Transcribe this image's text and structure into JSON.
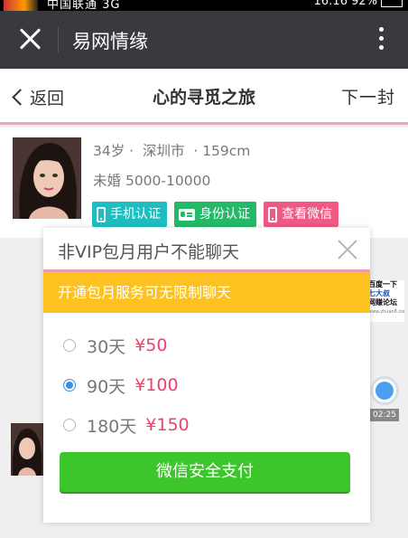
{
  "status_bar": {
    "carrier": "中国联通 3G",
    "time_battery": "16:16 92%"
  },
  "title_bar": {
    "title": "易网情缘"
  },
  "header": {
    "back_label": "返回",
    "title": "心的寻觅之旅",
    "next_label": "下一封"
  },
  "profile": {
    "age": "34岁",
    "city": "深圳市",
    "height": "159cm",
    "marital": "未婚",
    "income": "5000-10000",
    "badges": [
      {
        "label": "手机认证",
        "icon": "phone-icon",
        "color": "#1fbdbf"
      },
      {
        "label": "身份认证",
        "icon": "id-card-icon",
        "color": "#24b968"
      },
      {
        "label": "查看微信",
        "icon": "phone-icon",
        "color": "#ef5a84"
      }
    ]
  },
  "background": {
    "ad_lines": [
      "百度一下",
      "七大叔",
      "网赚论坛",
      "www.zhuan8.com"
    ],
    "voice_duration": "02:25"
  },
  "modal": {
    "title": "非VIP包月用户不能聊天",
    "banner": "开通包月服务可无限制聊天",
    "options": [
      {
        "days": "30天",
        "price": "¥50",
        "selected": false
      },
      {
        "days": "90天",
        "price": "¥100",
        "selected": true
      },
      {
        "days": "180天",
        "price": "¥150",
        "selected": false
      }
    ],
    "pay_label": "微信安全支付"
  },
  "colors": {
    "accent_pink": "#f09ab0",
    "banner_yellow": "#fdc21f",
    "pay_green": "#3dc52c",
    "price_red": "#f23f6a"
  }
}
